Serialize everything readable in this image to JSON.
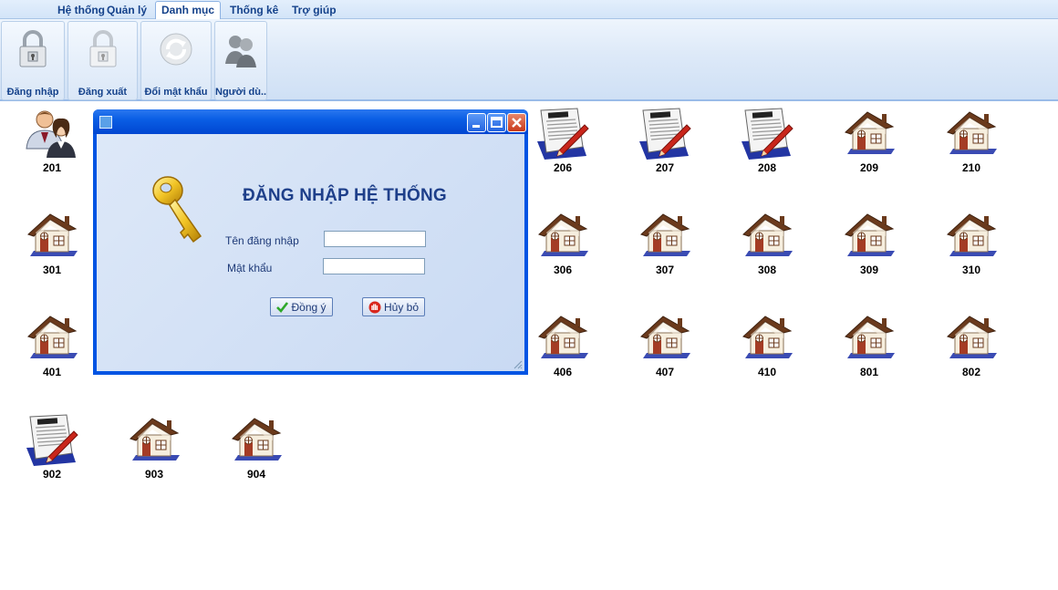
{
  "menu": {
    "tabs": [
      {
        "label": "Hệ thống"
      },
      {
        "label": "Quản lý"
      },
      {
        "label": "Danh mục"
      },
      {
        "label": "Thống kê"
      },
      {
        "label": "Trợ giúp"
      }
    ],
    "active": "Danh mục"
  },
  "ribbon": {
    "login_label": "Đăng nhập",
    "logout_label": "Đăng xuất",
    "change_password_label": "Đổi mật khẩu",
    "users_label": "Người dù..."
  },
  "rooms": [
    {
      "number": "201",
      "icon": "users-icon"
    },
    {
      "number": "206",
      "icon": "document-pen-icon"
    },
    {
      "number": "207",
      "icon": "document-pen-icon"
    },
    {
      "number": "208",
      "icon": "document-pen-icon"
    },
    {
      "number": "209",
      "icon": "house-icon"
    },
    {
      "number": "210",
      "icon": "house-icon"
    },
    {
      "number": "301",
      "icon": "house-icon"
    },
    {
      "number": "306",
      "icon": "house-icon"
    },
    {
      "number": "307",
      "icon": "house-icon"
    },
    {
      "number": "308",
      "icon": "house-icon"
    },
    {
      "number": "309",
      "icon": "house-icon"
    },
    {
      "number": "310",
      "icon": "house-icon"
    },
    {
      "number": "401",
      "icon": "house-icon"
    },
    {
      "number": "406",
      "icon": "house-icon"
    },
    {
      "number": "407",
      "icon": "house-icon"
    },
    {
      "number": "410",
      "icon": "house-icon"
    },
    {
      "number": "801",
      "icon": "house-icon"
    },
    {
      "number": "802",
      "icon": "house-icon"
    },
    {
      "number": "902",
      "icon": "document-pen-icon"
    },
    {
      "number": "903",
      "icon": "house-icon"
    },
    {
      "number": "904",
      "icon": "house-icon"
    }
  ],
  "login_dialog": {
    "heading": "ĐĂNG NHẬP HỆ THỐNG",
    "username_label": "Tên đăng nhập",
    "username_value": "",
    "password_label": "Mật khẩu",
    "password_value": "",
    "ok_label": "Đồng ý",
    "cancel_label": "Hủy bỏ",
    "icon": "key-icon"
  },
  "colors": {
    "ribbon_text": "#15428b",
    "dialog_frame": "#0054e3",
    "heading": "#1e3f8a"
  }
}
